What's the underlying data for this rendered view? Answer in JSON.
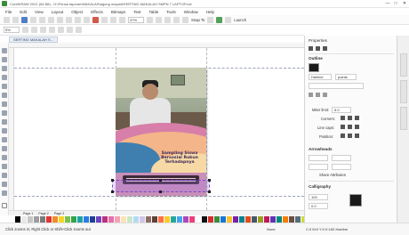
{
  "window": {
    "title": "CorelDRAW 2021 (64-Bit) - D:\\Peusa laporan\\MAKALAH\\agung mayadi\\SERTING MAKALAH SMPN 7 LAPTOP.cdr",
    "minimize": "—",
    "maximize": "□",
    "close": "✕"
  },
  "menubar": [
    "File",
    "Edit",
    "View",
    "Layout",
    "Object",
    "Effects",
    "Bitmaps",
    "Text",
    "Table",
    "Tools",
    "Window",
    "Help"
  ],
  "toolbar": {
    "zoom": "37%",
    "snap_to": "Snap To",
    "launch": "Launch"
  },
  "propbar": {
    "zoom_field": "5%"
  },
  "document_tab": {
    "label": "SERTING MAKALAH S..."
  },
  "page_content": {
    "headline": "Sampling Siswa Bersosial Rukun Terhadapnya"
  },
  "page_nav": {
    "pages": [
      "Page 1",
      "Page 2",
      "Page 3"
    ]
  },
  "properties_docker": {
    "title": "Properties",
    "outline_section": "Outline",
    "outline_width": "Hairline",
    "outline_units": "points",
    "miter_label": "Miter limit:",
    "miter_value": "5.0",
    "corners_label": "Corners:",
    "line_caps_label": "Line caps:",
    "position_label": "Position:",
    "arrowheads_label": "Arrowheads",
    "options_label": "Options",
    "share_attributes": "Share Attributes",
    "calligraphy_section": "Calligraphy",
    "stretch_value": "100",
    "angle_value": "0.0"
  },
  "statusbar": {
    "hint": "Click zooms in; Right Click or Shift+Click zooms out",
    "fill_label": "None",
    "outline_label": "C:0 M:0 Y:0 K:100  Hairline"
  },
  "palette_colors": [
    "#ffffff",
    "#000000",
    "#e8e8e8",
    "#c6c6c6",
    "#9e9e9e",
    "#7a7a7a",
    "#e3342f",
    "#f28b2c",
    "#f9d423",
    "#7cc24a",
    "#2ea44f",
    "#19a3a3",
    "#2c7be5",
    "#1c3f95",
    "#6f42c1",
    "#b83280",
    "#e96fa8",
    "#f4a3b5",
    "#fde2b3",
    "#c8e6c9",
    "#b3d9f2",
    "#d1c4e9",
    "#8d6e63",
    "#5d4037",
    "#ff7043",
    "#ffca28",
    "#26a69a",
    "#42a5f5",
    "#ab47bc",
    "#ec407a",
    "#ffffff",
    "#111111",
    "#d32f2f",
    "#388e3c",
    "#1976d2",
    "#fbc02d",
    "#7b1fa2",
    "#00838f",
    "#e64a19",
    "#455a64",
    "#9e9d24",
    "#c2185b",
    "#5e35b1",
    "#00897b",
    "#f57c00",
    "#6d4c41",
    "#546e7a",
    "#cddc39",
    "#ef9a9a",
    "#80cbc4",
    "#90caf9",
    "#ce93d8",
    "#ffe082",
    "#a5d6a7",
    "#e0e0e0",
    "#424242",
    "#b71c1c",
    "#1b5e20",
    "#0d47a1",
    "#f9a825"
  ]
}
